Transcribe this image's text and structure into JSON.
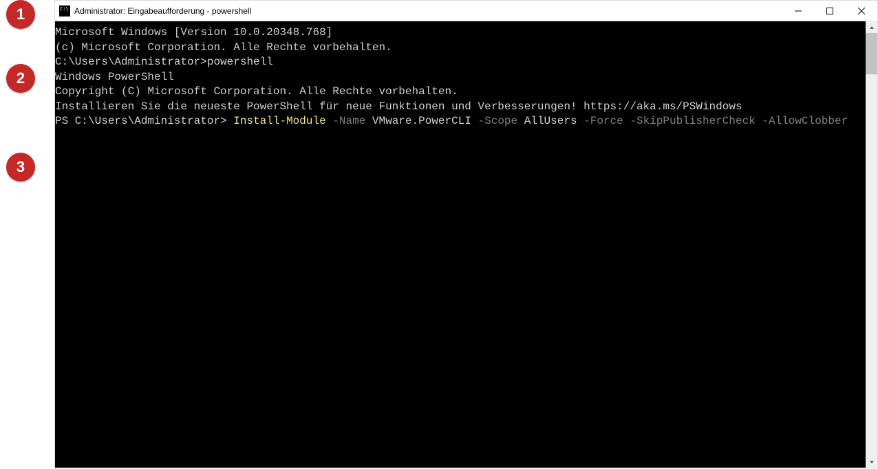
{
  "callouts": {
    "c1": "1",
    "c2": "2",
    "c3": "3"
  },
  "window": {
    "title": "Administrator: Eingabeaufforderung - powershell"
  },
  "terminal": {
    "line1": "Microsoft Windows [Version 10.0.20348.768]",
    "line2": "(c) Microsoft Corporation. Alle Rechte vorbehalten.",
    "line3": "",
    "line4": "C:\\Users\\Administrator>powershell",
    "line5": "Windows PowerShell",
    "line6": "Copyright (C) Microsoft Corporation. Alle Rechte vorbehalten.",
    "line7": "",
    "line8": "Installieren Sie die neueste PowerShell für neue Funktionen und Verbesserungen! https://aka.ms/PSWindows",
    "line9": "",
    "ps": {
      "prompt": "PS C:\\Users\\Administrator> ",
      "cmd": "Install-Module",
      "p_name": " -Name ",
      "a_name": "VMware.PowerCLI",
      "p_scope": " -Scope ",
      "a_scope": "AllUsers",
      "p_force": " -Force",
      "p_skip": " -SkipPublisherCheck",
      "p_clobber": " -AllowClobber"
    }
  }
}
